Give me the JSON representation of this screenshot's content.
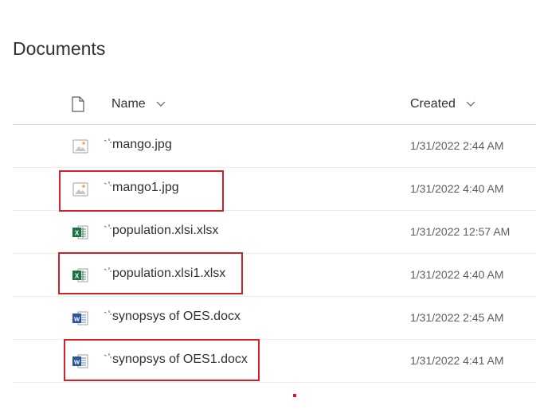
{
  "library": {
    "title": "Documents"
  },
  "columns": {
    "name": "Name",
    "created": "Created"
  },
  "files": [
    {
      "name": "mango.jpg",
      "created": "1/31/2022 2:44 AM",
      "type": "image",
      "highlighted": false
    },
    {
      "name": "mango1.jpg",
      "created": "1/31/2022 4:40 AM",
      "type": "image",
      "highlighted": true
    },
    {
      "name": "population.xlsi.xlsx",
      "created": "1/31/2022 12:57 AM",
      "type": "excel",
      "highlighted": false
    },
    {
      "name": "population.xlsi1.xlsx",
      "created": "1/31/2022 4:40 AM",
      "type": "excel",
      "highlighted": true
    },
    {
      "name": "synopsys of OES.docx",
      "created": "1/31/2022 2:45 AM",
      "type": "word",
      "highlighted": false
    },
    {
      "name": "synopsys of OES1.docx",
      "created": "1/31/2022 4:41 AM",
      "type": "word",
      "highlighted": true
    }
  ],
  "colors": {
    "highlight": "#d32128",
    "excel": "#1e7145",
    "word": "#2b579a"
  }
}
